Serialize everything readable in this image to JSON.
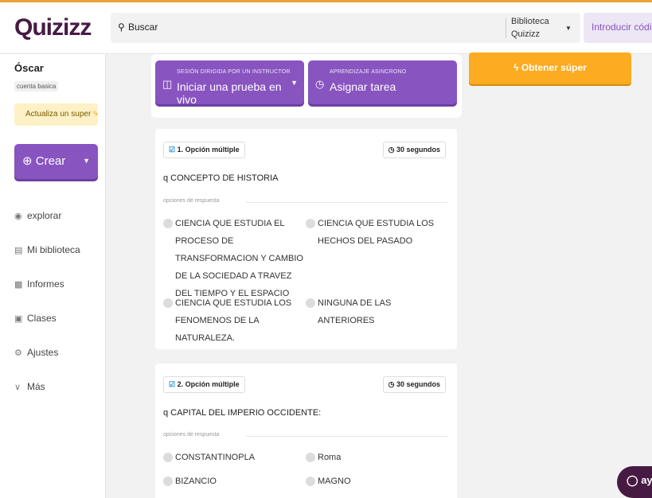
{
  "header": {
    "logo": "Quizizz",
    "search_placeholder": "Buscar",
    "library_select": "Biblioteca Quizizz",
    "join_code": "Introducir código"
  },
  "sidebar": {
    "user_name": "Óscar",
    "account_type": "cuenta basica",
    "upgrade_label": "Actualiza un super",
    "create_label": "Crear",
    "nav": [
      {
        "label": "explorar",
        "icon": "compass-icon"
      },
      {
        "label": "Mi biblioteca",
        "icon": "library-icon"
      },
      {
        "label": "Informes",
        "icon": "chart-icon"
      },
      {
        "label": "Clases",
        "icon": "classes-icon"
      },
      {
        "label": "Ajustes",
        "icon": "gear-icon"
      },
      {
        "label": "Más",
        "icon": "chevron-down-icon"
      }
    ]
  },
  "actions": {
    "live": {
      "sub": "SESIÓN DIRIGIDA POR UN INSTRUCTOR",
      "main": "Iniciar una prueba en vivo"
    },
    "assign": {
      "sub": "APRENDIZAJE ASINCRONO",
      "main": "Asignar tarea"
    },
    "super": "Obtener súper"
  },
  "questions": [
    {
      "type": "1. Opción múltiple",
      "time": "30 segundos",
      "text": "q CONCEPTO DE HISTORIA",
      "options_label": "opciones de respuesta",
      "options": [
        "CIENCIA QUE ESTUDIA EL PROCESO DE TRANSFORMACION Y CAMBIO DE LA SOCIEDAD A TRAVEZ DEL TIEMPO Y EL ESPACIO",
        "CIENCIA QUE ESTUDIA LOS HECHOS DEL PASADO",
        "CIENCIA QUE ESTUDIA LOS FENOMENOS DE LA NATURALEZA.",
        "NINGUNA DE LAS ANTERIORES"
      ]
    },
    {
      "type": "2. Opción múltiple",
      "time": "30 segundos",
      "text": "q CAPITAL DEL IMPERIO OCCIDENTE:",
      "options_label": "opciones de respuesta",
      "options": [
        "CONSTANTINOPLA",
        "Roma",
        "BIZANCIO",
        "MAGNO"
      ]
    }
  ],
  "help_label": "ayu"
}
